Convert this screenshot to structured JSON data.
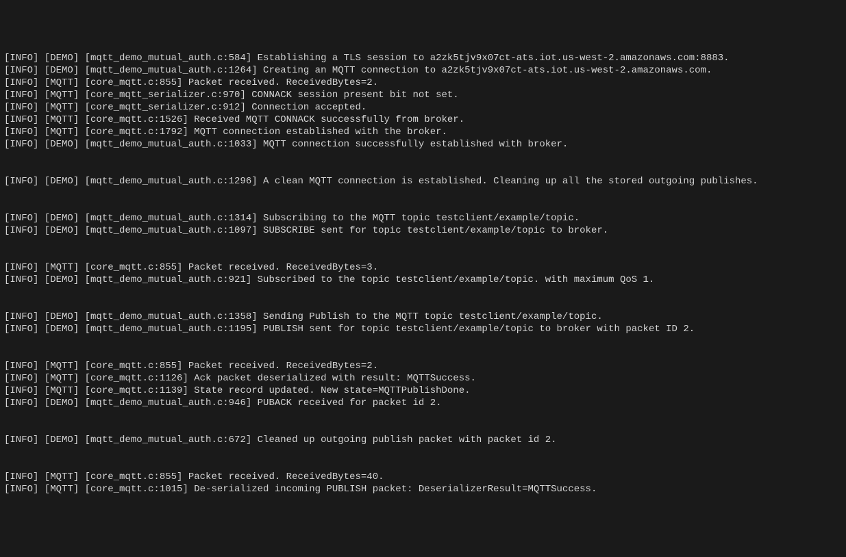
{
  "terminal": {
    "lines": [
      "[INFO] [DEMO] [mqtt_demo_mutual_auth.c:584] Establishing a TLS session to a2zk5tjv9x07ct-ats.iot.us-west-2.amazonaws.com:8883.",
      "[INFO] [DEMO] [mqtt_demo_mutual_auth.c:1264] Creating an MQTT connection to a2zk5tjv9x07ct-ats.iot.us-west-2.amazonaws.com.",
      "[INFO] [MQTT] [core_mqtt.c:855] Packet received. ReceivedBytes=2.",
      "[INFO] [MQTT] [core_mqtt_serializer.c:970] CONNACK session present bit not set.",
      "[INFO] [MQTT] [core_mqtt_serializer.c:912] Connection accepted.",
      "[INFO] [MQTT] [core_mqtt.c:1526] Received MQTT CONNACK successfully from broker.",
      "[INFO] [MQTT] [core_mqtt.c:1792] MQTT connection established with the broker.",
      "[INFO] [DEMO] [mqtt_demo_mutual_auth.c:1033] MQTT connection successfully established with broker.",
      "",
      "",
      "[INFO] [DEMO] [mqtt_demo_mutual_auth.c:1296] A clean MQTT connection is established. Cleaning up all the stored outgoing publishes.",
      "",
      "",
      "[INFO] [DEMO] [mqtt_demo_mutual_auth.c:1314] Subscribing to the MQTT topic testclient/example/topic.",
      "[INFO] [DEMO] [mqtt_demo_mutual_auth.c:1097] SUBSCRIBE sent for topic testclient/example/topic to broker.",
      "",
      "",
      "[INFO] [MQTT] [core_mqtt.c:855] Packet received. ReceivedBytes=3.",
      "[INFO] [DEMO] [mqtt_demo_mutual_auth.c:921] Subscribed to the topic testclient/example/topic. with maximum QoS 1.",
      "",
      "",
      "[INFO] [DEMO] [mqtt_demo_mutual_auth.c:1358] Sending Publish to the MQTT topic testclient/example/topic.",
      "[INFO] [DEMO] [mqtt_demo_mutual_auth.c:1195] PUBLISH sent for topic testclient/example/topic to broker with packet ID 2.",
      "",
      "",
      "[INFO] [MQTT] [core_mqtt.c:855] Packet received. ReceivedBytes=2.",
      "[INFO] [MQTT] [core_mqtt.c:1126] Ack packet deserialized with result: MQTTSuccess.",
      "[INFO] [MQTT] [core_mqtt.c:1139] State record updated. New state=MQTTPublishDone.",
      "[INFO] [DEMO] [mqtt_demo_mutual_auth.c:946] PUBACK received for packet id 2.",
      "",
      "",
      "[INFO] [DEMO] [mqtt_demo_mutual_auth.c:672] Cleaned up outgoing publish packet with packet id 2.",
      "",
      "",
      "[INFO] [MQTT] [core_mqtt.c:855] Packet received. ReceivedBytes=40.",
      "[INFO] [MQTT] [core_mqtt.c:1015] De-serialized incoming PUBLISH packet: DeserializerResult=MQTTSuccess."
    ]
  }
}
